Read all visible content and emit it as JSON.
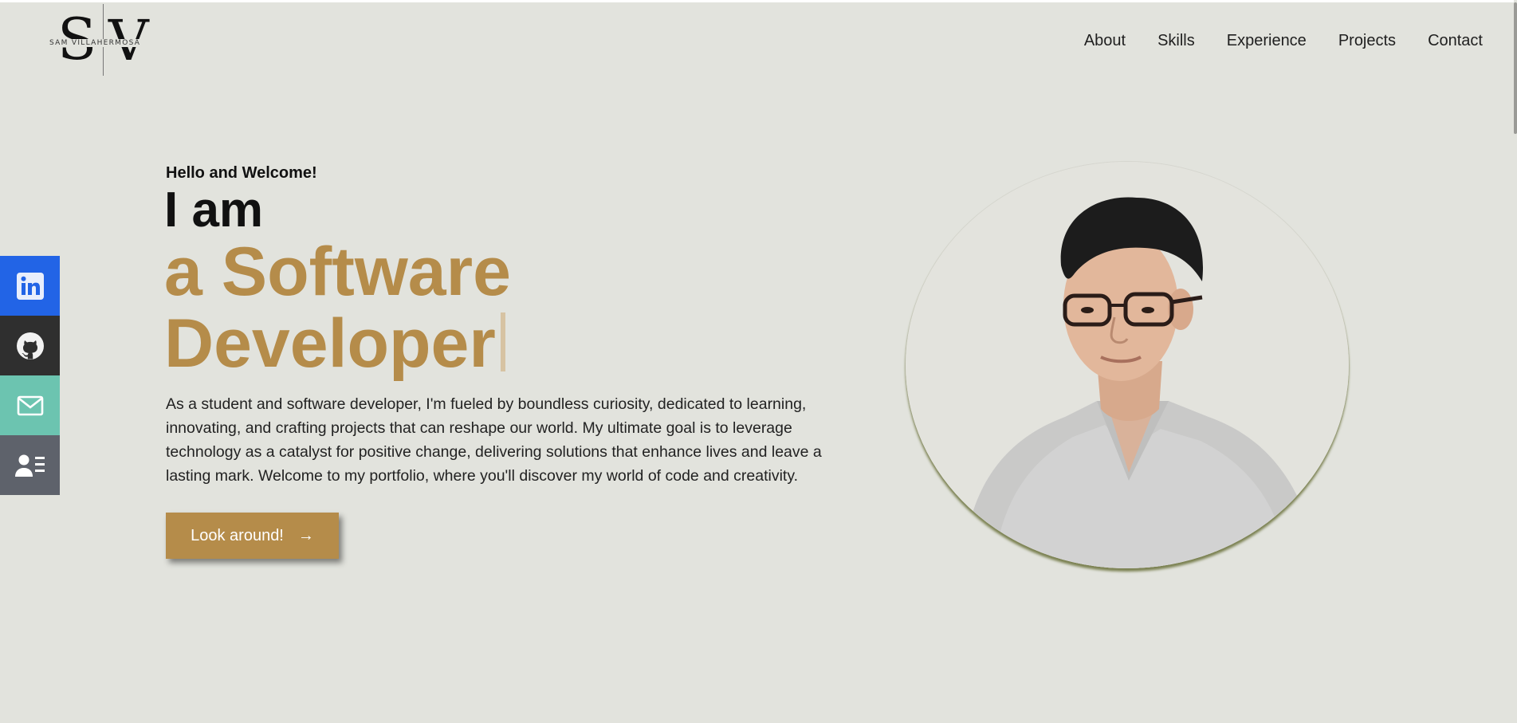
{
  "logo": {
    "initial_s": "S",
    "initial_v": "V",
    "name": "SAM VILLAHERMOSA"
  },
  "nav": {
    "items": [
      "About",
      "Skills",
      "Experience",
      "Projects",
      "Contact"
    ]
  },
  "social": {
    "items": [
      {
        "icon": "linkedin-icon",
        "color": "#2264e6"
      },
      {
        "icon": "github-icon",
        "color": "#2f2f2f"
      },
      {
        "icon": "mail-icon",
        "color": "#6cc4b0"
      },
      {
        "icon": "resume-icon",
        "color": "#5e626b"
      }
    ]
  },
  "hero": {
    "greeting": "Hello and Welcome!",
    "intro": "I am",
    "role_line1": "a Software",
    "role_line2": "Developer",
    "bio": "As a student and software developer, I'm fueled by boundless curiosity, dedicated to learning, innovating, and crafting projects that can reshape our world. My ultimate goal is to leverage technology as a catalyst for positive change, delivering solutions that enhance lives and leave a lasting mark. Welcome to my portfolio, where you'll discover my world of code and creativity.",
    "cta_label": "Look around!",
    "cta_arrow": "→"
  },
  "colors": {
    "background": "#e2e3dd",
    "accent": "#b58c4a"
  }
}
